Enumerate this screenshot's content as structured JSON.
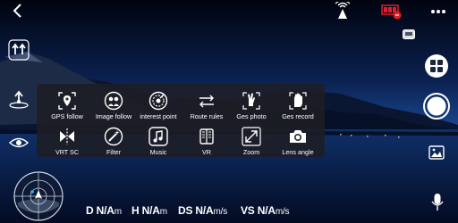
{
  "status": {
    "battery_color": "#e11d2a"
  },
  "menu": {
    "items": [
      {
        "label": "GPS follow",
        "icon": "gps-follow-icon"
      },
      {
        "label": "Image follow",
        "icon": "image-follow-icon"
      },
      {
        "label": "interest point",
        "icon": "interest-point-icon"
      },
      {
        "label": "Route rules",
        "icon": "route-rules-icon"
      },
      {
        "label": "Ges photo",
        "icon": "gesture-photo-icon"
      },
      {
        "label": "Ges record",
        "icon": "gesture-record-icon"
      },
      {
        "label": "VRT SC",
        "icon": "vrt-sc-icon"
      },
      {
        "label": "Filter",
        "icon": "filter-icon"
      },
      {
        "label": "Music",
        "icon": "music-icon"
      },
      {
        "label": "VR",
        "icon": "vr-icon"
      },
      {
        "label": "Zoom",
        "icon": "zoom-icon"
      },
      {
        "label": "Lens angle",
        "icon": "lens-angle-icon"
      }
    ]
  },
  "telemetry": {
    "d": {
      "label": "D",
      "value": "N/A",
      "unit": "m"
    },
    "h": {
      "label": "H",
      "value": "N/A",
      "unit": "m"
    },
    "ds": {
      "label": "DS",
      "value": "N/A",
      "unit": "m/s"
    },
    "vs": {
      "label": "VS",
      "value": "N/A",
      "unit": "m/s"
    }
  }
}
